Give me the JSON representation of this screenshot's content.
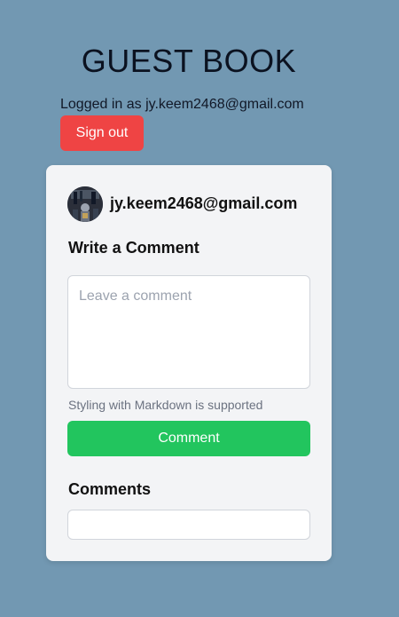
{
  "page": {
    "title": "GUEST BOOK",
    "logged_in_text": "Logged in as jy.keem2468@gmail.com",
    "sign_out_label": "Sign out"
  },
  "colors": {
    "background": "#7298b2",
    "sign_out": "#ef4444",
    "comment_button": "#22c55e",
    "card": "#f3f4f6"
  },
  "card": {
    "user": {
      "email": "jy.keem2468@gmail.com",
      "avatar_icon": "user-avatar-image"
    },
    "write_heading": "Write a Comment",
    "comment_input": {
      "value": "",
      "placeholder": "Leave a comment"
    },
    "markdown_hint": "Styling with Markdown is supported",
    "comment_button_label": "Comment",
    "comments_heading": "Comments",
    "comments": []
  }
}
